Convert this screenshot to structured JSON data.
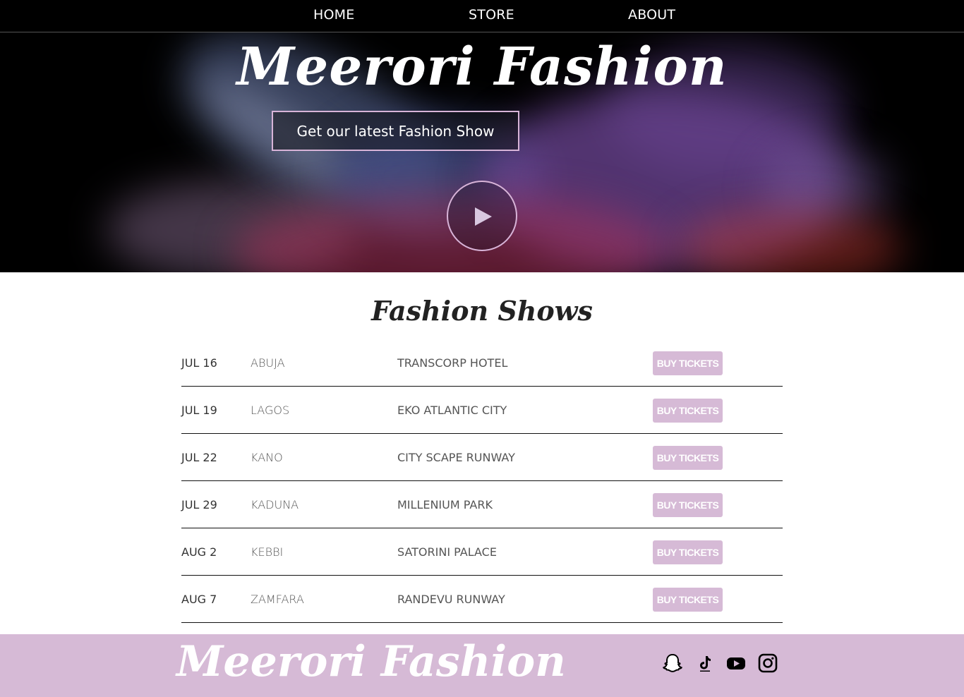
{
  "nav": {
    "home": "HOME",
    "store": "STORE",
    "about": "ABOUT"
  },
  "hero": {
    "title": "Meerori Fashion",
    "cta_label": "Get our latest Fashion Show"
  },
  "shows": {
    "title": "Fashion Shows",
    "rows": [
      {
        "date": "JUL 16",
        "city": "ABUJA",
        "venue": "TRANSCORP HOTEL",
        "button": "BUY TICKETS"
      },
      {
        "date": "JUL 19",
        "city": "LAGOS",
        "venue": "EKO ATLANTIC CITY",
        "button": "BUY TICKETS"
      },
      {
        "date": "JUL 22",
        "city": "KANO",
        "venue": "CITY SCAPE RUNWAY",
        "button": "BUY TICKETS"
      },
      {
        "date": "JUL 29",
        "city": "KADUNA",
        "venue": "MILLENIUM PARK",
        "button": "BUY TICKETS"
      },
      {
        "date": "AUG 2",
        "city": "KEBBI",
        "venue": "SATORINI PALACE",
        "button": "BUY TICKETS"
      },
      {
        "date": "AUG 7",
        "city": "ZAMFARA",
        "venue": "RANDEVU RUNWAY",
        "button": "BUY TICKETS"
      }
    ]
  },
  "footer": {
    "title": "Meerori Fashion",
    "social_icons": [
      "snapchat-icon",
      "tiktok-icon",
      "youtube-icon",
      "instagram-icon"
    ]
  },
  "colors": {
    "nav_bg": "#000000",
    "accent": "#d6bad6",
    "text": "#222222"
  }
}
